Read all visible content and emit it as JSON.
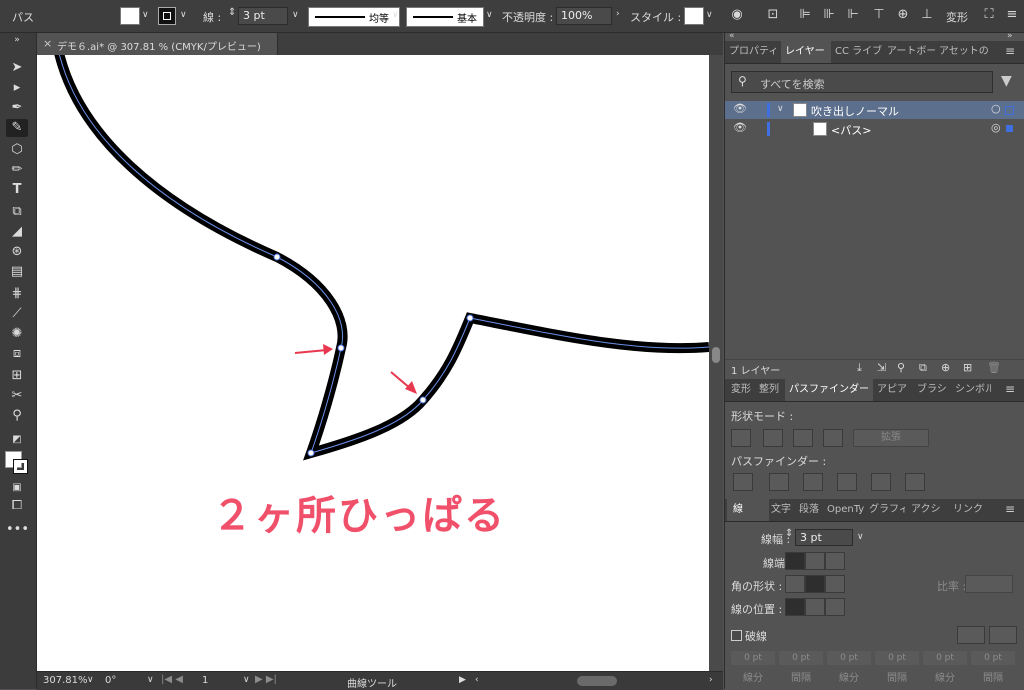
{
  "control_bar": {
    "object_type": "パス",
    "stroke_label": "線 :",
    "stroke_value": "3 pt",
    "profile_label": "均等",
    "brush_label": "基本",
    "opacity_label": "不透明度 :",
    "opacity_value": "100%",
    "style_label": "スタイル :",
    "transform_label": "変形"
  },
  "document": {
    "tab_title": "デモ６.ai* @ 307.81 % (CMYK/プレビュー)",
    "close_symbol": "×"
  },
  "canvas": {
    "annotation": "２ヶ所ひっぱる",
    "annotation_color": "#f0506a",
    "arrow_color": "#e8384f",
    "path_color": "#000000",
    "path_highlight_color": "#6b8fe8"
  },
  "status_bar": {
    "zoom": "307.81%",
    "rotation": "0°",
    "artboard": "1",
    "tool": "曲線ツール"
  },
  "layers_panel": {
    "tabs": [
      "プロパティ",
      "レイヤー",
      "CC ライブ",
      "アートボー",
      "アセットの"
    ],
    "search_placeholder": "すべてを検索",
    "layer_name": "吹き出しノーマル",
    "sublayer_name": "<パス>",
    "footer_count": "1 レイヤー"
  },
  "pathfinder_panel": {
    "tabs": [
      "変形",
      "整列",
      "パスファインダー",
      "アピア",
      "ブラシ",
      "シンボル"
    ],
    "shape_modes_label": "形状モード :",
    "expand_label": "拡張",
    "pathfinders_label": "パスファインダー :"
  },
  "stroke_panel": {
    "tabs": [
      "線",
      "文字",
      "段落",
      "OpenTy",
      "グラフィ",
      "アクシ",
      "リンク"
    ],
    "weight_label": "線幅 :",
    "weight_value": "3 pt",
    "cap_label": "線端 :",
    "corner_label": "角の形状 :",
    "limit_label": "比率 :",
    "align_label": "線の位置 :",
    "dashed_label": "破線",
    "dash_fields": [
      "0 pt",
      "0 pt",
      "0 pt",
      "0 pt",
      "0 pt",
      "0 pt"
    ],
    "dash_labels": [
      "線分",
      "間隔",
      "線分",
      "間隔",
      "線分",
      "間隔"
    ]
  }
}
